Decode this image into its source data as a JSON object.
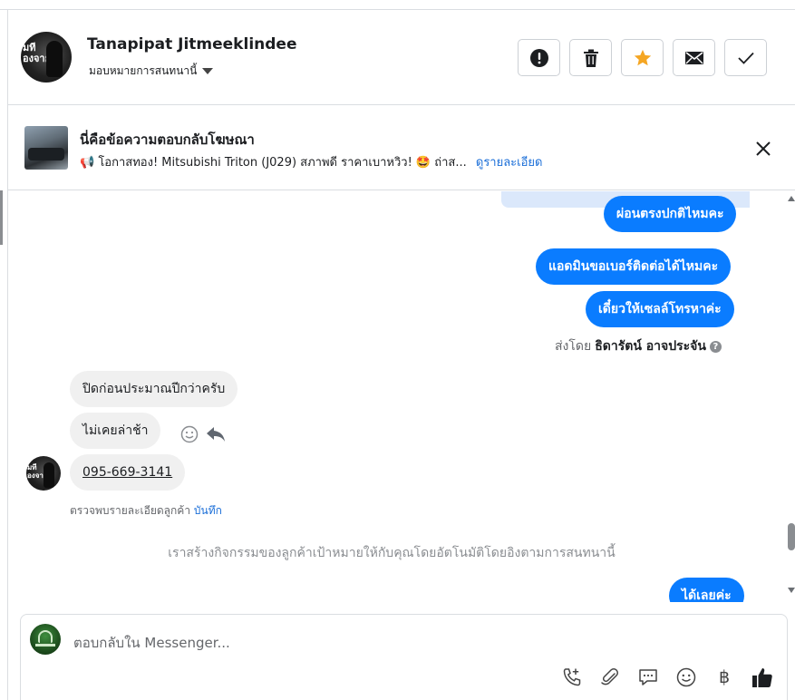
{
  "header": {
    "contact_name": "Tanapipat Jitmeeklindee",
    "assign_label": "มอบหมายการสนทนานี้",
    "avatar_text": "มที\nองจาย",
    "actions": [
      {
        "icon": "alert-circle-icon",
        "label": "Mark as spam"
      },
      {
        "icon": "trash-icon",
        "label": "Delete"
      },
      {
        "icon": "star-icon",
        "label": "Star",
        "color": "#f5a623"
      },
      {
        "icon": "mail-icon",
        "label": "Mark as unread"
      },
      {
        "icon": "check-icon",
        "label": "Mark as done"
      }
    ]
  },
  "ad_reply": {
    "title": "นี่คือข้อความตอบกลับโฆษณา",
    "description": "📢 โอกาสทอง! Mitsubishi Triton (J029) สภาพดี ราคาเบาหวิว! 🤩 ถ่าส...",
    "link_label": "ดูรายละเอียด",
    "close_icon": "close-icon"
  },
  "messages": {
    "outgoing_top": [
      "ผ่อนตรงปกติไหมคะ",
      "แอดมินขอเบอร์ติดต่อได้ไหมคะ",
      "เดี๋ยวให้เซลล์โทรหาค่ะ"
    ],
    "sent_by_prefix": "ส่งโดย",
    "sent_by_name": "ธิดารัตน์ อาจประจัน",
    "incoming": [
      "ปิดก่อนประมาณปีกว่าครับ",
      "ไม่เคยล่าช้า",
      "095-669-3141"
    ],
    "detect_text": "ตรวจพบรายละเอียดลูกค้า",
    "detect_link": "บันทึก",
    "system_message": "เราสร้างกิจกรรมของลูกค้าเป้าหมายให้กับคุณโดยอัตโนมัติโดยอิงตามการสนทนานี้",
    "outgoing_bottom": "ได้เลยค่ะ"
  },
  "composer": {
    "placeholder": "ตอบกลับใน Messenger...",
    "tools": [
      "phone-plus-icon",
      "paperclip-icon",
      "chat-bubble-icon",
      "emoji-icon",
      "baht-icon",
      "thumbs-up-icon"
    ],
    "baht_symbol": "฿"
  },
  "colors": {
    "accent": "#0a7cff",
    "link": "#1a6ed8",
    "star": "#f5a623",
    "incoming_bubble": "#f0f0f0"
  }
}
